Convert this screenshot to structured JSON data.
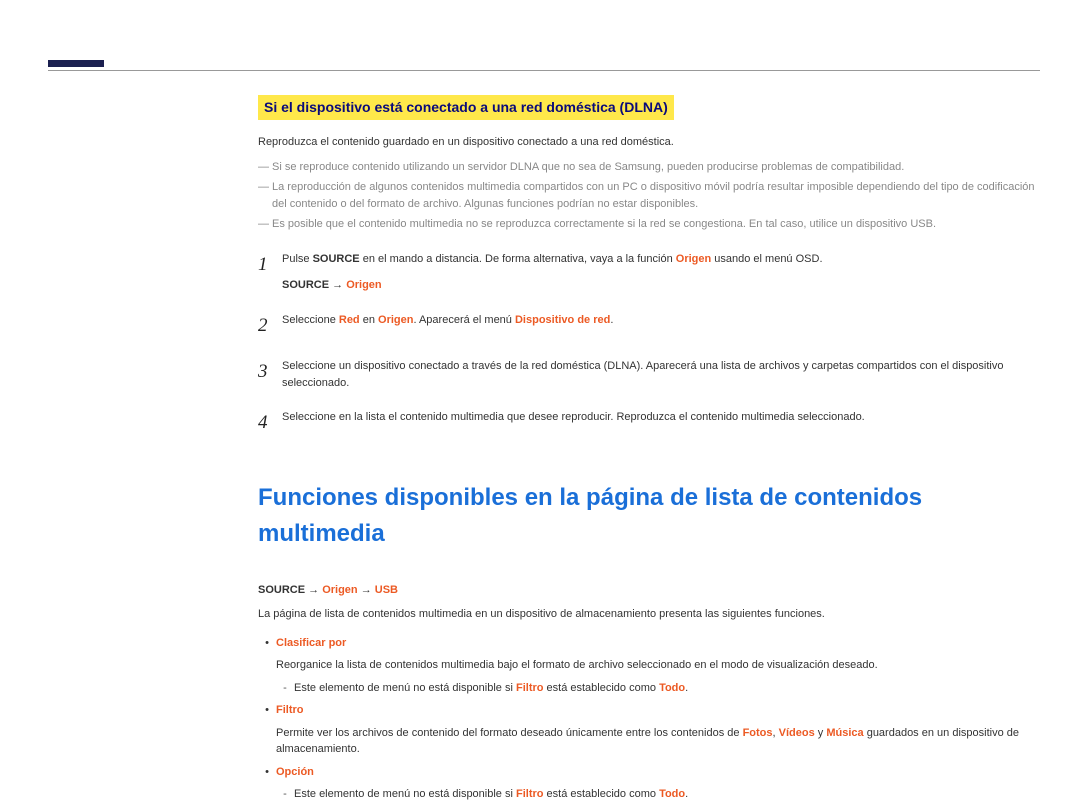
{
  "heading": "Si el dispositivo está conectado a una red doméstica (DLNA)",
  "intro": "Reproduzca el contenido guardado en un dispositivo conectado a una red doméstica.",
  "notes": [
    "Si se reproduce contenido utilizando un servidor DLNA que no sea de Samsung, pueden producirse problemas de compatibilidad.",
    "La reproducción de algunos contenidos multimedia compartidos con un PC o dispositivo móvil podría resultar imposible dependiendo del tipo de codificación del contenido o del formato de archivo. Algunas funciones podrían no estar disponibles.",
    "Es posible que el contenido multimedia no se reproduzca correctamente si la red se congestiona. En tal caso, utilice un dispositivo USB."
  ],
  "steps": {
    "s1": {
      "pre": "Pulse ",
      "source": "SOURCE",
      "mid": " en el mando a distancia. De forma alternativa, vaya a la función ",
      "origen": "Origen",
      "post": " usando el menú OSD.",
      "crumb_source": "SOURCE",
      "crumb_arrow": " → ",
      "crumb_origen": "Origen"
    },
    "s2": {
      "pre": "Seleccione ",
      "red": "Red",
      "mid": " en ",
      "origen": "Origen",
      "mid2": ". Aparecerá el menú ",
      "disp": "Dispositivo de red",
      "post": "."
    },
    "s3": "Seleccione un dispositivo conectado a través de la red doméstica (DLNA). Aparecerá una lista de archivos y carpetas compartidos con el dispositivo seleccionado.",
    "s4": "Seleccione en la lista el contenido multimedia que desee reproducir. Reproduzca el contenido multimedia seleccionado."
  },
  "num1": "1",
  "num2": "2",
  "num3": "3",
  "num4": "4",
  "section2_title": "Funciones disponibles en la página de lista de contenidos multimedia",
  "crumb2": {
    "source": "SOURCE",
    "arrow1": " → ",
    "origen": "Origen",
    "arrow2": " → ",
    "usb": "USB"
  },
  "section2_intro": "La página de lista de contenidos multimedia en un dispositivo de almacenamiento presenta las siguientes funciones.",
  "bullets": {
    "b1_title": "Clasificar por",
    "b1_line": "Reorganice la lista de contenidos multimedia bajo el formato de archivo seleccionado en el modo de visualización deseado.",
    "b1_sub_pre": "Este elemento de menú no está disponible si ",
    "b1_sub_filtro": "Filtro",
    "b1_sub_mid": " está establecido como ",
    "b1_sub_todo": "Todo",
    "b1_sub_post": ".",
    "b2_title": "Filtro",
    "b2_pre": "Permite ver los archivos de contenido del formato deseado únicamente entre los contenidos de ",
    "b2_fotos": "Fotos",
    "b2_sep1": ", ",
    "b2_videos": "Vídeos",
    "b2_sep2": " y ",
    "b2_musica": "Música",
    "b2_post": " guardados en un dispositivo de almacenamiento.",
    "b3_title": "Opción",
    "b3_sub_pre": "Este elemento de menú no está disponible si ",
    "b3_sub_filtro": "Filtro",
    "b3_sub_mid": " está establecido como ",
    "b3_sub_todo": "Todo",
    "b3_sub_post": "."
  }
}
